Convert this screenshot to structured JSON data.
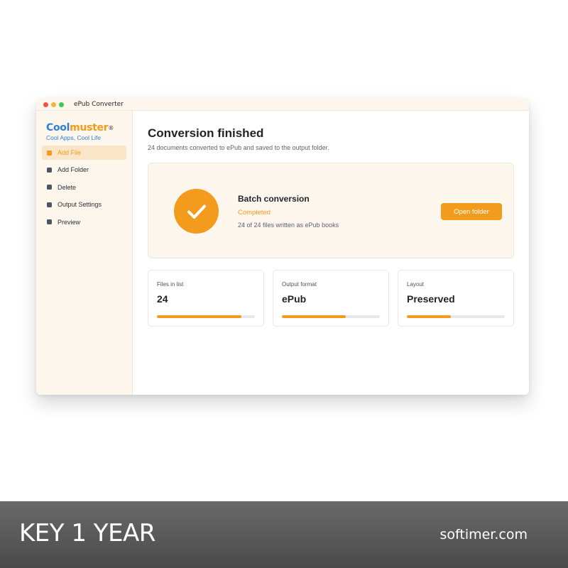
{
  "window": {
    "title": "ePub Converter"
  },
  "logo": {
    "brand_a": "Cool",
    "brand_b": "muster",
    "reg": "®",
    "tagline": "Cool Apps, Cool Life"
  },
  "sidebar": {
    "items": [
      {
        "label": "Add File",
        "active": true
      },
      {
        "label": "Add Folder",
        "active": false
      },
      {
        "label": "Delete",
        "active": false
      },
      {
        "label": "Output Settings",
        "active": false
      },
      {
        "label": "Preview",
        "active": false
      }
    ]
  },
  "main": {
    "title": "Conversion finished",
    "subtitle": "24 documents converted to ePub and saved to the output folder."
  },
  "status": {
    "heading": "Batch conversion",
    "state": "Completed",
    "detail": "24 of 24 files written as ePub books",
    "button_label": "Open folder"
  },
  "stats": [
    {
      "label": "Files in list",
      "value": "24",
      "progress": 0.86
    },
    {
      "label": "Output format",
      "value": "ePub",
      "progress": 0.65
    },
    {
      "label": "Layout",
      "value": "Preserved",
      "progress": 0.45
    }
  ],
  "colors": {
    "accent": "#f29b1c",
    "logo_blue": "#2f7fd8",
    "sidebar_bg": "#fdf6ec"
  },
  "banner": {
    "left": "KEY 1 YEAR",
    "right": "softimer.com"
  }
}
